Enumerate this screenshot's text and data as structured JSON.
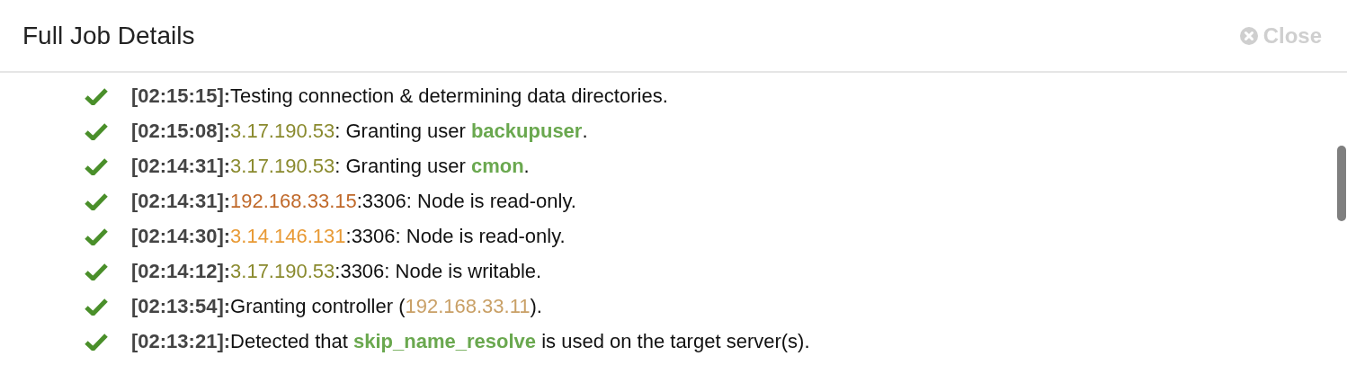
{
  "dialog": {
    "title": "Full Job Details",
    "close_label": "Close"
  },
  "log": [
    {
      "timestamp": "[02:15:15]:",
      "parts": [
        {
          "kind": "text",
          "text": "Testing connection & determining data directories."
        }
      ]
    },
    {
      "timestamp": "[02:15:08]:",
      "parts": [
        {
          "kind": "host",
          "text": "3.17.190.53",
          "color": "#8a8a2e"
        },
        {
          "kind": "text",
          "text": ": Granting user "
        },
        {
          "kind": "keyword",
          "text": "backupuser"
        },
        {
          "kind": "text",
          "text": "."
        }
      ]
    },
    {
      "timestamp": "[02:14:31]:",
      "parts": [
        {
          "kind": "host",
          "text": "3.17.190.53",
          "color": "#8a8a2e"
        },
        {
          "kind": "text",
          "text": ": Granting user "
        },
        {
          "kind": "keyword",
          "text": "cmon"
        },
        {
          "kind": "text",
          "text": "."
        }
      ]
    },
    {
      "timestamp": "[02:14:31]:",
      "parts": [
        {
          "kind": "host",
          "text": "192.168.33.15",
          "color": "#c0692a"
        },
        {
          "kind": "text",
          "text": ":3306: Node is read-only."
        }
      ]
    },
    {
      "timestamp": "[02:14:30]:",
      "parts": [
        {
          "kind": "host",
          "text": "3.14.146.131",
          "color": "#e89a35"
        },
        {
          "kind": "text",
          "text": ":3306: Node is read-only."
        }
      ]
    },
    {
      "timestamp": "[02:14:12]:",
      "parts": [
        {
          "kind": "host",
          "text": "3.17.190.53",
          "color": "#8a8a2e"
        },
        {
          "kind": "text",
          "text": ":3306: Node is writable."
        }
      ]
    },
    {
      "timestamp": "[02:13:54]:",
      "parts": [
        {
          "kind": "text",
          "text": "Granting controller ("
        },
        {
          "kind": "host",
          "text": "192.168.33.11",
          "color": "#c9a066"
        },
        {
          "kind": "text",
          "text": ")."
        }
      ]
    },
    {
      "timestamp": "[02:13:21]:",
      "parts": [
        {
          "kind": "text",
          "text": "Detected that "
        },
        {
          "kind": "keyword",
          "text": "skip_name_resolve"
        },
        {
          "kind": "text",
          "text": " is used on the target server(s)."
        }
      ]
    }
  ]
}
